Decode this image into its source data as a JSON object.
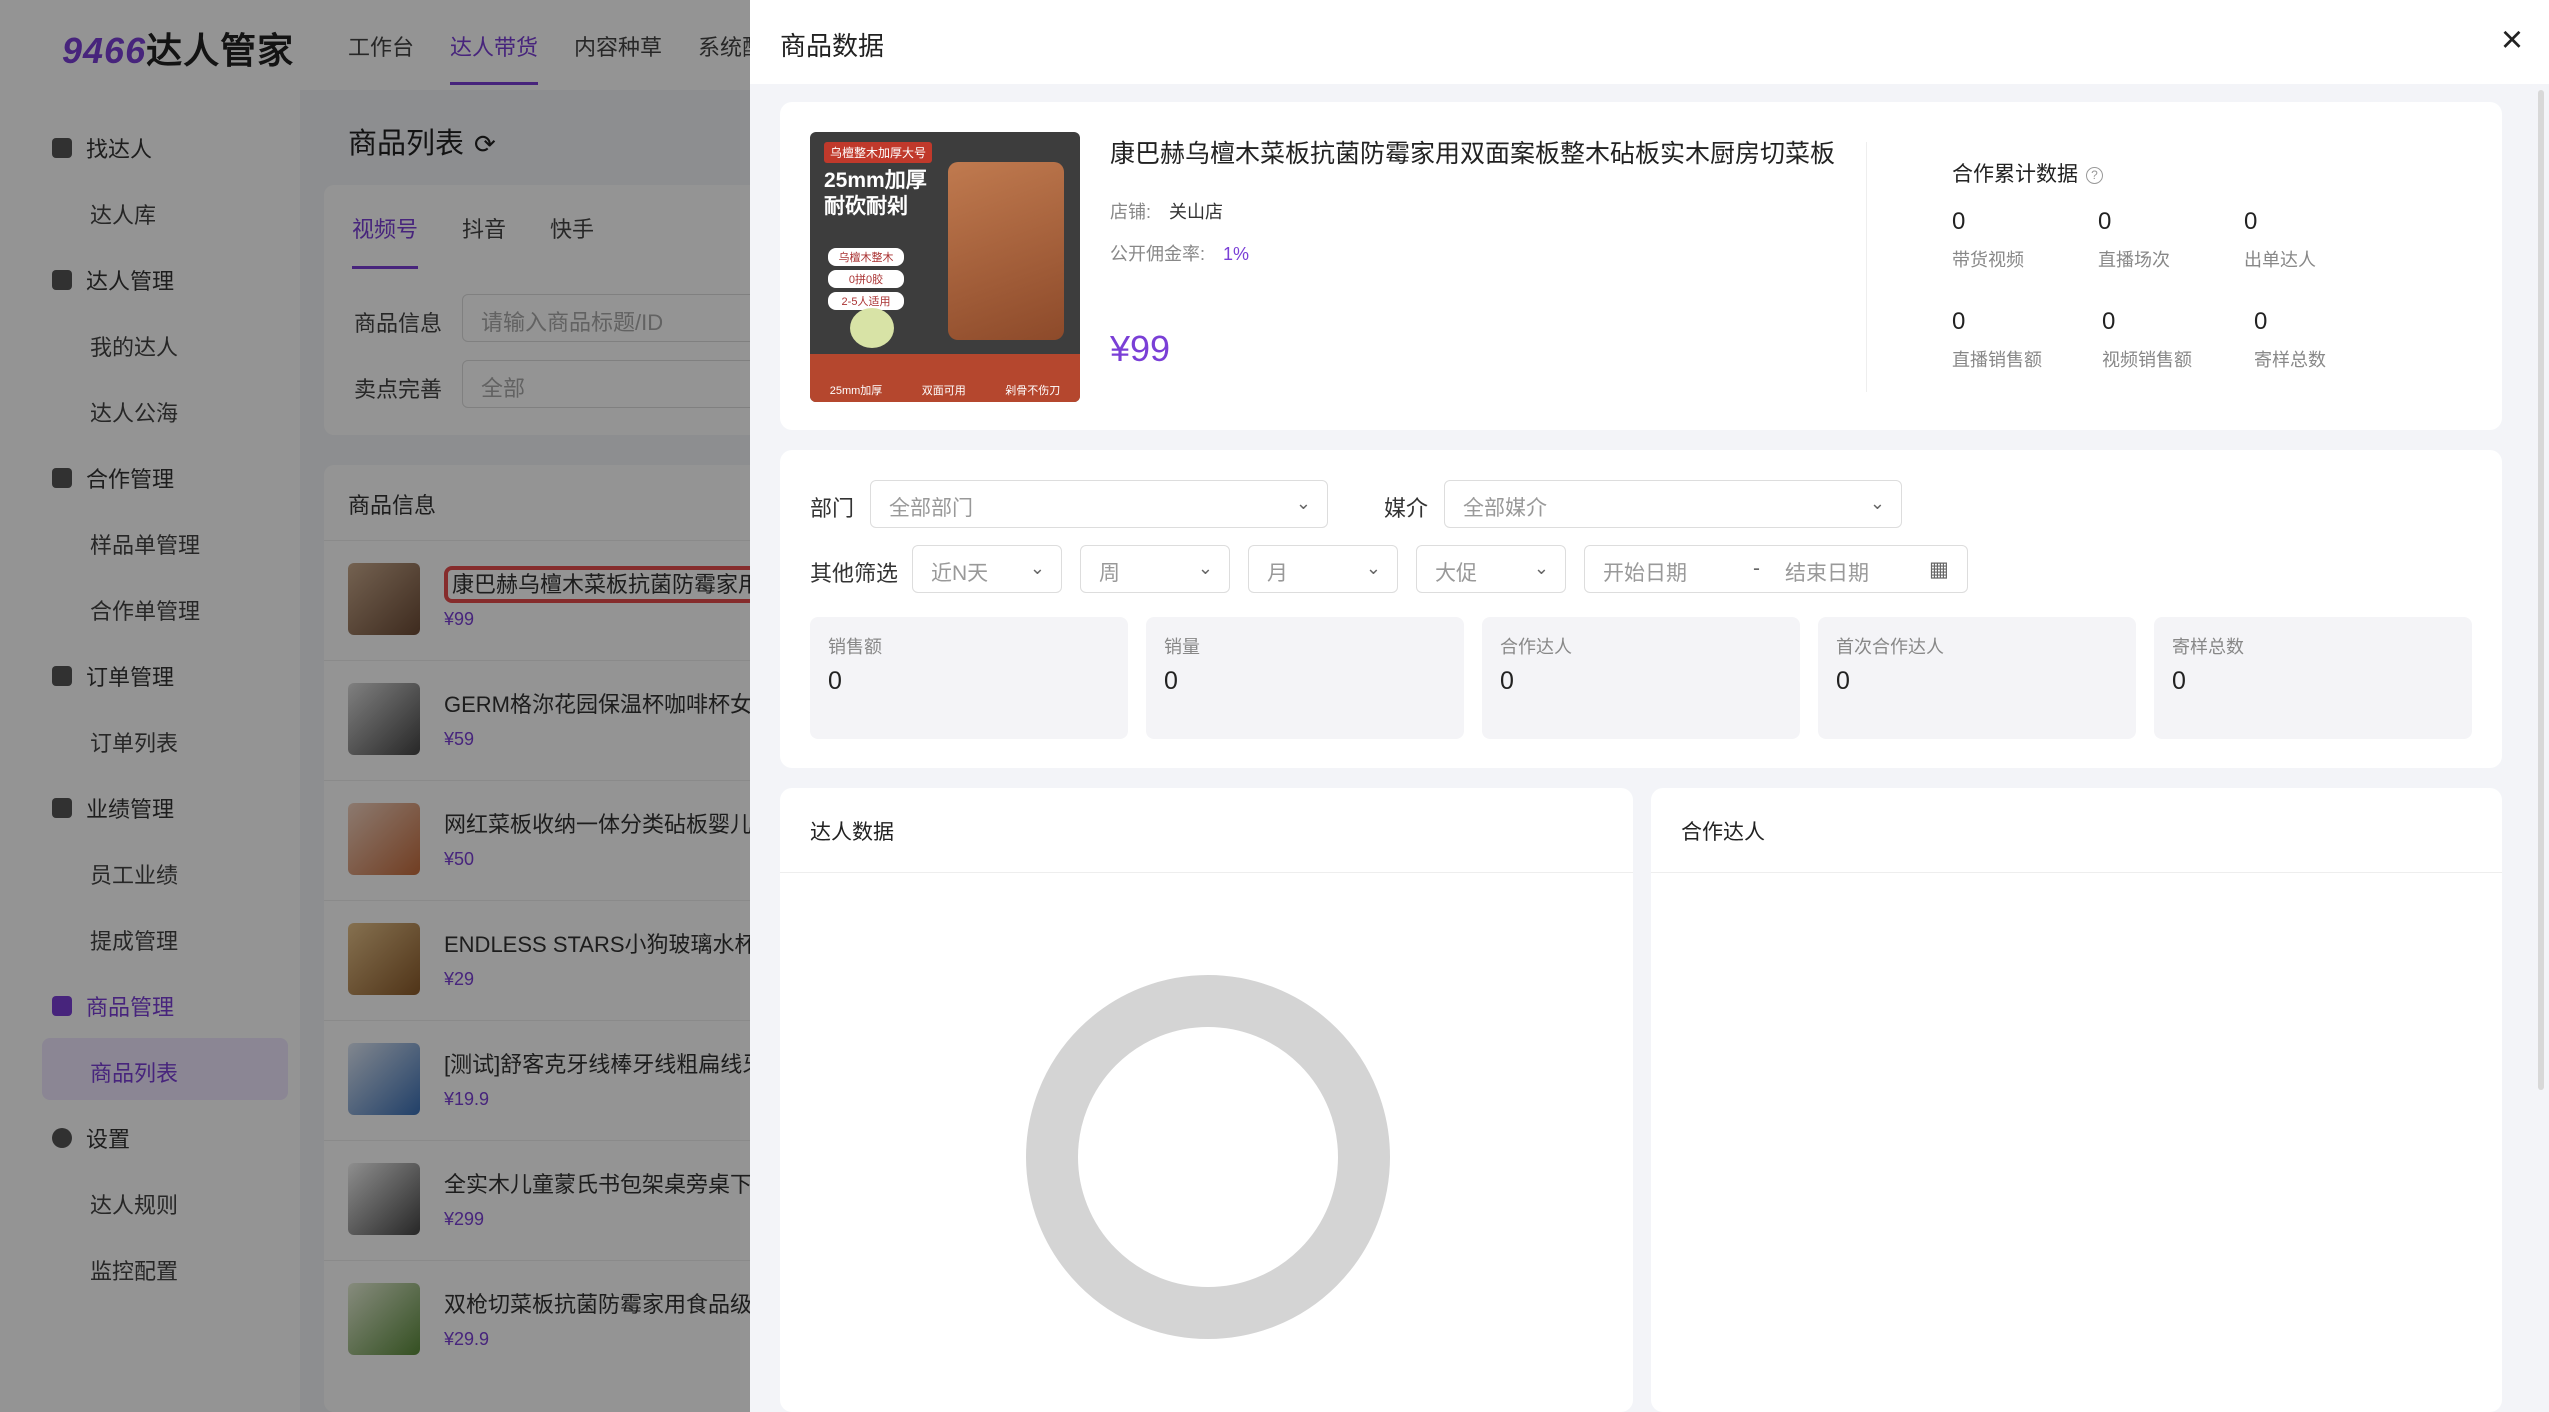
{
  "app": {
    "logo_num": "9466",
    "logo_text": "达人管家",
    "topnav": [
      "工作台",
      "达人带货",
      "内容种草",
      "系统配"
    ],
    "sidebar": {
      "find_group": "找达人",
      "talent_lib": "达人库",
      "manage_group": "达人管理",
      "my_talent": "我的达人",
      "public_pool": "达人公海",
      "coop_group": "合作管理",
      "sample_orders": "样品单管理",
      "coop_orders": "合作单管理",
      "order_group": "订单管理",
      "order_list": "订单列表",
      "perf_group": "业绩管理",
      "staff_perf": "员工业绩",
      "commission": "提成管理",
      "goods_group": "商品管理",
      "goods_list": "商品列表",
      "settings_group": "设置",
      "talent_rules": "达人规则",
      "monitor": "监控配置"
    },
    "list_title": "商品列表",
    "platform_tabs": [
      "视频号",
      "抖音",
      "快手"
    ],
    "filter": {
      "info_label": "商品信息",
      "info_placeholder": "请输入商品标题/ID",
      "selling_label": "卖点完善",
      "selling_value": "全部"
    },
    "list_header": "商品信息",
    "products": [
      {
        "name": "康巴赫乌檀木菜板抗菌防霉家用双",
        "price": "¥99"
      },
      {
        "name": "GERM格沵花园保温杯咖啡杯女高",
        "price": "¥59"
      },
      {
        "name": "网红菜板收纳一体分类砧板婴儿辅",
        "price": "¥50"
      },
      {
        "name": "ENDLESS STARS小狗玻璃水杯咖",
        "price": "¥29"
      },
      {
        "name": "[测试]舒客克牙线棒牙线粗扁线牙",
        "price": "¥19.9"
      },
      {
        "name": "全实木儿童蒙氏书包架桌旁桌下可",
        "price": "¥299"
      },
      {
        "name": "双枪切菜板抗菌防霉家用食品级砧",
        "price": "¥29.9"
      }
    ]
  },
  "drawer": {
    "title": "商品数据",
    "close": "×",
    "product": {
      "title": "康巴赫乌檀木菜板抗菌防霉家用双面案板整木砧板实木厨房切菜板",
      "shop_label": "店铺:",
      "shop_value": "关山店",
      "rate_label": "公开佣金率:",
      "rate_value": "1%",
      "price": "¥99",
      "image": {
        "tag": "乌檀整木加厚大号",
        "headline1": "25mm加厚",
        "headline2": "耐砍耐剁",
        "chips": [
          "乌檀木整木",
          "0拼0胶",
          "2-5人适用"
        ],
        "bottom": [
          "25mm加厚",
          "双面可用",
          "剁骨不伤刀"
        ]
      }
    },
    "coop_stats": {
      "title": "合作累计数据",
      "help": "?",
      "items": [
        {
          "value": "0",
          "label": "带货视频"
        },
        {
          "value": "0",
          "label": "直播场次"
        },
        {
          "value": "0",
          "label": "出单达人"
        },
        {
          "value": "0",
          "label": "直播销售额"
        },
        {
          "value": "0",
          "label": "视频销售额"
        },
        {
          "value": "0",
          "label": "寄样总数"
        }
      ]
    },
    "filters": {
      "dept_label": "部门",
      "dept_value": "全部部门",
      "media_label": "媒介",
      "media_value": "全部媒介",
      "other_label": "其他筛选",
      "recent": "近N天",
      "week": "周",
      "month": "月",
      "promo": "大促",
      "start_date": "开始日期",
      "sep": "-",
      "end_date": "结束日期"
    },
    "metrics": [
      {
        "label": "销售额",
        "value": "0"
      },
      {
        "label": "销量",
        "value": "0"
      },
      {
        "label": "合作达人",
        "value": "0"
      },
      {
        "label": "首次合作达人",
        "value": "0"
      },
      {
        "label": "寄样总数",
        "value": "0"
      }
    ],
    "talent_panel_title": "达人数据",
    "coop_panel_title": "合作达人"
  },
  "colors": {
    "accent": "#7a3fd6",
    "highlight": "#e74c4c",
    "donut": "#d4d4d4"
  }
}
